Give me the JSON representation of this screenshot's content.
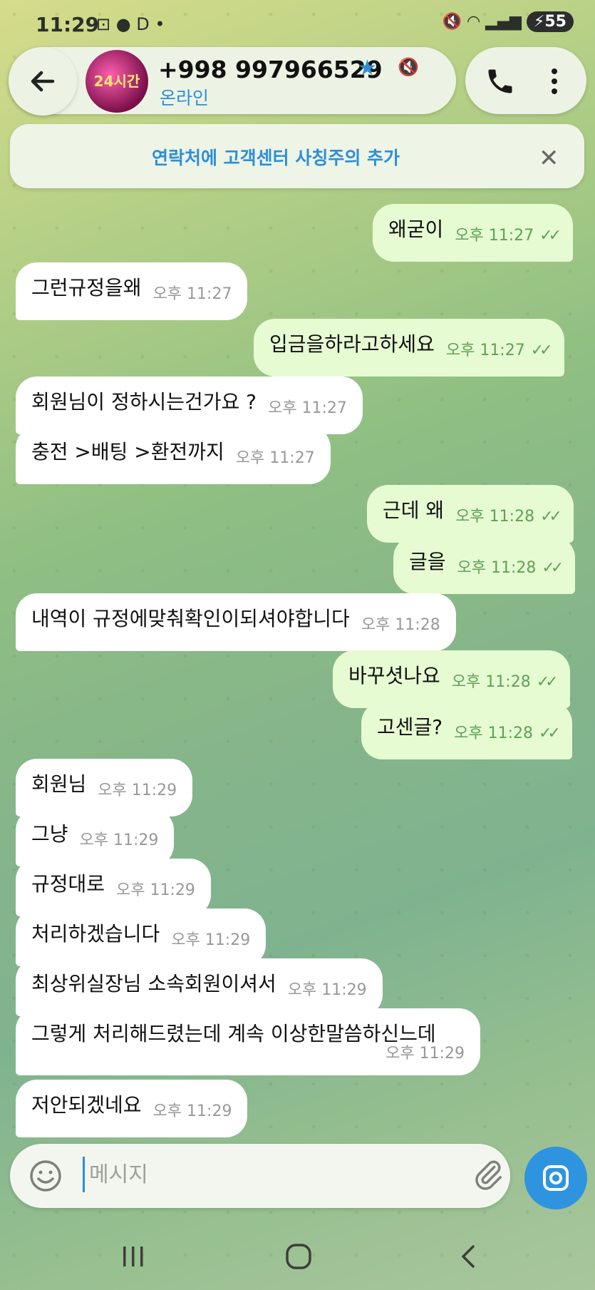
{
  "status_bar": {
    "time": "11:29",
    "left_icons": "⊡ ● D •",
    "battery": "55"
  },
  "header": {
    "contact_name": "+998 997966529",
    "status": "온라인",
    "avatar_text": "24시간"
  },
  "banner": {
    "text": "연락처에 고객센터 사칭주의 추가",
    "close_label": "✕"
  },
  "messages": [
    {
      "side": "out",
      "text": "왜굳이",
      "time": "오후 11:27",
      "read": true
    },
    {
      "side": "in",
      "text": "그런규정을왜",
      "time": "오후 11:27"
    },
    {
      "side": "out",
      "text": "입금을하라고하세요",
      "time": "오후 11:27",
      "read": true
    },
    {
      "side": "in",
      "text": "회원님이 정하시는건가요 ?",
      "time": "오후 11:27"
    },
    {
      "side": "in",
      "text": "충전 >배팅 >환전까지",
      "time": "오후 11:27"
    },
    {
      "side": "out",
      "text": "근데 왜",
      "time": "오후 11:28",
      "read": true
    },
    {
      "side": "out",
      "text": "글을",
      "time": "오후 11:28",
      "read": true
    },
    {
      "side": "in",
      "text": "내역이 규정에맞춰확인이되셔야합니다",
      "time": "오후 11:28"
    },
    {
      "side": "out",
      "text": "바꾸셧나요",
      "time": "오후 11:28",
      "read": true
    },
    {
      "side": "out",
      "text": "고센글?",
      "time": "오후 11:28",
      "read": true
    },
    {
      "side": "in",
      "text": "회원님",
      "time": "오후 11:29"
    },
    {
      "side": "in",
      "text": "그냥",
      "time": "오후 11:29"
    },
    {
      "side": "in",
      "text": "규정대로",
      "time": "오후 11:29"
    },
    {
      "side": "in",
      "text": "처리하겠습니다",
      "time": "오후 11:29"
    },
    {
      "side": "in",
      "text": "최상위실장님 소속회원이셔서",
      "time": "오후 11:29"
    },
    {
      "side": "in",
      "text": "그렇게 처리해드렸는데 계속 이상한말씀하신느데",
      "time": "오후 11:29"
    },
    {
      "side": "in",
      "text": "저안되겠네요",
      "time": "오후 11:29"
    }
  ],
  "composer": {
    "placeholder": "메시지"
  },
  "ticks": "✓✓"
}
